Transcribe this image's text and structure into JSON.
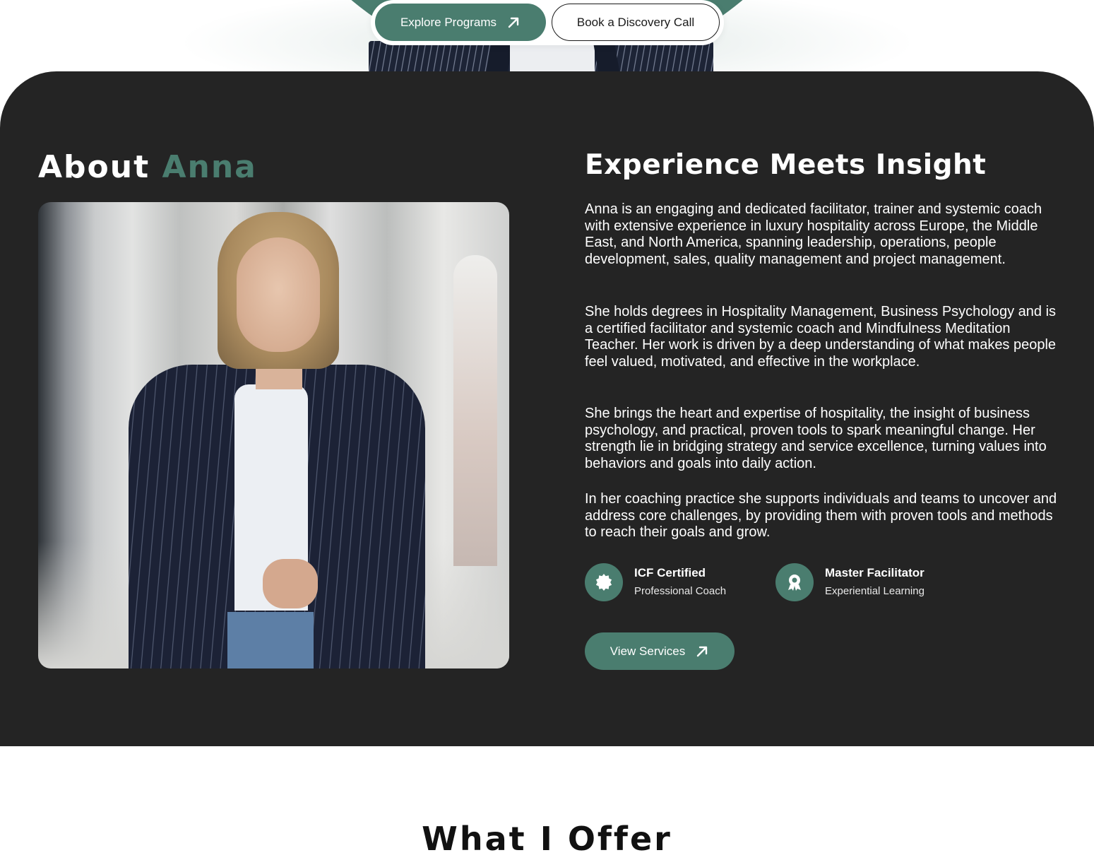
{
  "hero": {
    "explore_label": "Explore Programs",
    "discovery_label": "Book a Discovery Call"
  },
  "about": {
    "heading_prefix": "About",
    "heading_accent": "Anna",
    "subheading": "Experience Meets Insight",
    "paragraphs": [
      "Anna is an engaging and dedicated facilitator, trainer and systemic coach with extensive experience in luxury hospitality across Europe, the Middle East, and North America, spanning leadership, operations, people development, sales, quality management and project management.",
      "She holds degrees in Hospitality Management, Business Psychology and is a certified facilitator and systemic coach and Mindfulness Meditation Teacher. Her work is driven by a deep understanding of what makes people feel valued, motivated, and effective in the workplace.",
      "She brings the heart and expertise of hospitality, the insight of business psychology, and practical, proven tools to spark meaningful change. Her strength lie in bridging strategy and service excellence, turning values into behaviors and goals into daily action.",
      "In her coaching practice she supports individuals and teams to uncover and address core challenges, by providing them with proven tools and methods to reach their goals and grow."
    ],
    "credentials": [
      {
        "title": "ICF Certified",
        "subtitle": "Professional Coach",
        "icon": "seal-badge-icon"
      },
      {
        "title": "Master Facilitator",
        "subtitle": "Experiential Learning",
        "icon": "award-ribbon-icon"
      }
    ],
    "services_label": "View Services"
  },
  "offer": {
    "heading": "What I Offer"
  },
  "colors": {
    "accent": "#4a7d6f",
    "dark_section": "#242424",
    "white": "#ffffff"
  }
}
